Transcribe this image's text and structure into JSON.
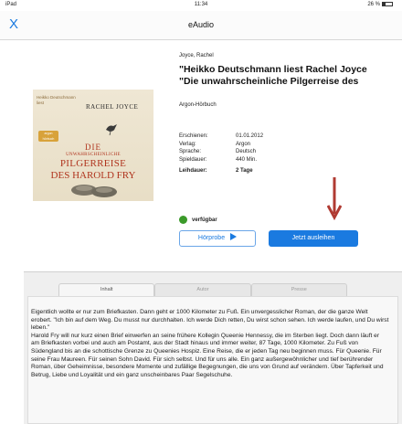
{
  "statusbar": {
    "left": "iPad",
    "time": "11:34",
    "battery": "26 %"
  },
  "nav": {
    "close": "X",
    "title": "eAudio"
  },
  "cover": {
    "top_text": "Heikko Deutschmann\nliest",
    "author": "RACHEL JOYCE",
    "badge": "argon hörbuch",
    "line1": "DIE",
    "line2": "UNWAHRSCHEINLICHE",
    "line3": "PILGERREISE",
    "line4": "DES HAROLD FRY"
  },
  "book": {
    "author": "Joyce, Rachel",
    "title_line1": "\"Heikko Deutschmann liest Rachel Joyce",
    "title_line2": "\"Die unwahrscheinliche Pilgerreise des",
    "publisher": "Argon-Hörbuch"
  },
  "meta": [
    {
      "key": "Erschienen:",
      "value": "01.01.2012"
    },
    {
      "key": "Verlag:",
      "value": "Argon"
    },
    {
      "key": "Sprache:",
      "value": "Deutsch"
    },
    {
      "key": "Spieldauer:",
      "value": "440 Min."
    }
  ],
  "loan": {
    "key": "Leihdauer:",
    "value": "2 Tage"
  },
  "availability": {
    "label": "verfügbar",
    "color": "#3b9a2a"
  },
  "buttons": {
    "preview": "Hörprobe",
    "borrow": "Jetzt ausleihen"
  },
  "tabs": [
    {
      "label": "Inhalt",
      "active": true
    },
    {
      "label": "Autor",
      "active": false
    },
    {
      "label": "Presse",
      "active": false
    }
  ],
  "content": {
    "p1": "Eigentlich wollte er nur zum Briefkasten. Dann geht er 1000 Kilometer zu Fuß. Ein unvergesslicher Roman, der die ganze Welt erobert. \"Ich bin auf dem Weg. Du musst nur durchhalten. Ich werde Dich retten, Du wirst schon sehen. Ich werde laufen, und Du wirst leben.\"",
    "p2": "Harold Fry will nur kurz einen Brief einwerfen an seine frühere Kollegin Queenie Hennessy, die im Sterben liegt. Doch dann läuft er am Briefkasten vorbei und auch am Postamt, aus der Stadt hinaus und immer weiter, 87 Tage, 1000 Kilometer. Zu Fuß von Südengland bis an die schottische Grenze zu Queenies Hospiz. Eine Reise, die er jeden Tag neu beginnen muss. Für Queenie. Für seine Frau Maureen. Für seinen Sohn David. Für sich selbst. Und für uns alle. Ein ganz außergewöhnlicher und tief berührender Roman, über Geheimnisse, besondere Momente und zufällige Begegnungen, die uns von Grund auf verändern. Über Tapferkeit und Betrug, Liebe und Loyalität und ein ganz unscheinbares Paar Segelschuhe."
  },
  "colors": {
    "accent": "#1a7ae0",
    "arrow": "#b03a32"
  }
}
